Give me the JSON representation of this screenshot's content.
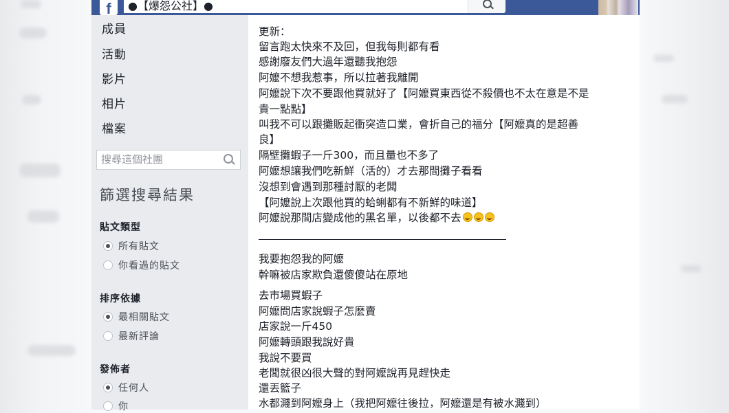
{
  "header": {
    "logo": "f",
    "group_name": "●【爆怨公社】●"
  },
  "sidebar": {
    "nav": [
      "成員",
      "活動",
      "影片",
      "相片",
      "檔案"
    ],
    "search_placeholder": "搜尋這個社團",
    "filter_title": "篩選搜尋結果",
    "post_type": {
      "title": "貼文類型",
      "options": [
        "所有貼文",
        "你看過的貼文"
      ],
      "selected": "所有貼文"
    },
    "sort_by": {
      "title": "排序依據",
      "options": [
        "最相關貼文",
        "最新評論"
      ],
      "selected": "最相關貼文"
    },
    "posted_by": {
      "title": "發佈者",
      "options": [
        "任何人",
        "你"
      ],
      "selected": "任何人"
    }
  },
  "post": {
    "update_lines": [
      "更新：",
      "留言跑太快來不及回，但我每則都有看",
      "感謝廢友們大過年還聽我抱怨",
      "阿嬤不想我惹事，所以拉著我離開",
      "阿嬤說下次不要跟他買就好了【阿嬤買東西從不殺價也不太在意是不是",
      "貴一點點】",
      "叫我不可以跟攤販起衝突造口業，會折自己的福分【阿嬤真的是超善",
      "良】",
      "隔壁攤蝦子一斤300，而且量也不多了",
      "阿嬤想讓我們吃新鮮（活的）才去那間攤子看看",
      "沒想到會遇到那種討厭的老闆",
      "【阿嬤說上次跟他買的蛤蜊都有不新鮮的味道】",
      "阿嬤說那間店變成他的黑名單，以後都不去"
    ],
    "intro_lines": [
      "我要抱怨我的阿嬤",
      "幹嘛被店家欺負還傻傻站在原地"
    ],
    "story_lines": [
      "去市場買蝦子",
      "阿嬤問店家說蝦子怎麼賣",
      "店家說一斤450",
      "阿嬤轉頭跟我說好貴",
      "我說不要買",
      "老闆就很凶很大聲的對阿嬤說再見趕快走",
      "還丟籃子",
      "水都濺到阿嬤身上（我把阿嬤往後拉，阿嬤還是有被水濺到）"
    ]
  }
}
